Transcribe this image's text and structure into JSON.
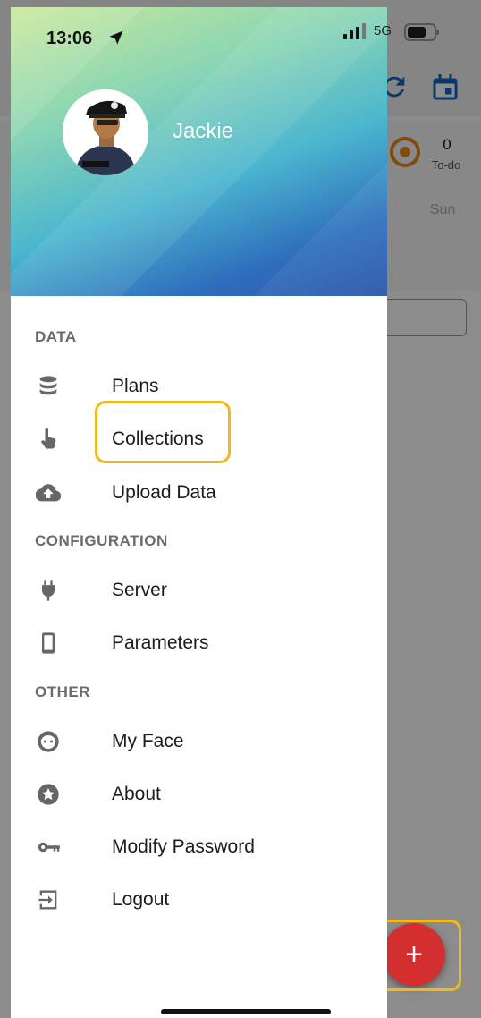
{
  "status_bar": {
    "time": "13:06",
    "network": "5G",
    "location_icon": "location-arrow-icon",
    "signal_icon": "signal-bars-icon",
    "battery_icon": "battery-icon"
  },
  "drawer": {
    "user_name": "Jackie",
    "avatar_icon": "security-guard-avatar",
    "sections": [
      {
        "title": "DATA",
        "items": [
          {
            "label": "Plans",
            "icon": "database-icon"
          },
          {
            "label": "Collections",
            "icon": "hand-pointer-icon",
            "highlighted": true
          },
          {
            "label": "Upload Data",
            "icon": "cloud-upload-icon"
          }
        ]
      },
      {
        "title": "CONFIGURATION",
        "items": [
          {
            "label": "Server",
            "icon": "plug-icon"
          },
          {
            "label": "Parameters",
            "icon": "phone-icon"
          }
        ]
      },
      {
        "title": "OTHER",
        "items": [
          {
            "label": "My Face",
            "icon": "face-icon"
          },
          {
            "label": "About",
            "icon": "star-circle-icon"
          },
          {
            "label": "Modify Password",
            "icon": "key-icon"
          },
          {
            "label": "Logout",
            "icon": "logout-icon"
          }
        ]
      }
    ]
  },
  "background_app": {
    "todo_count": "0",
    "todo_label": "To-do",
    "day_label": "Sun",
    "fab_symbol": "+",
    "icons": [
      "refresh-icon",
      "calendar-icon"
    ]
  },
  "colors": {
    "highlight": "#f3b81b",
    "fab": "#d32f2f",
    "todo_ring": "#e88a1a",
    "section_title": "#6b6b6b"
  }
}
